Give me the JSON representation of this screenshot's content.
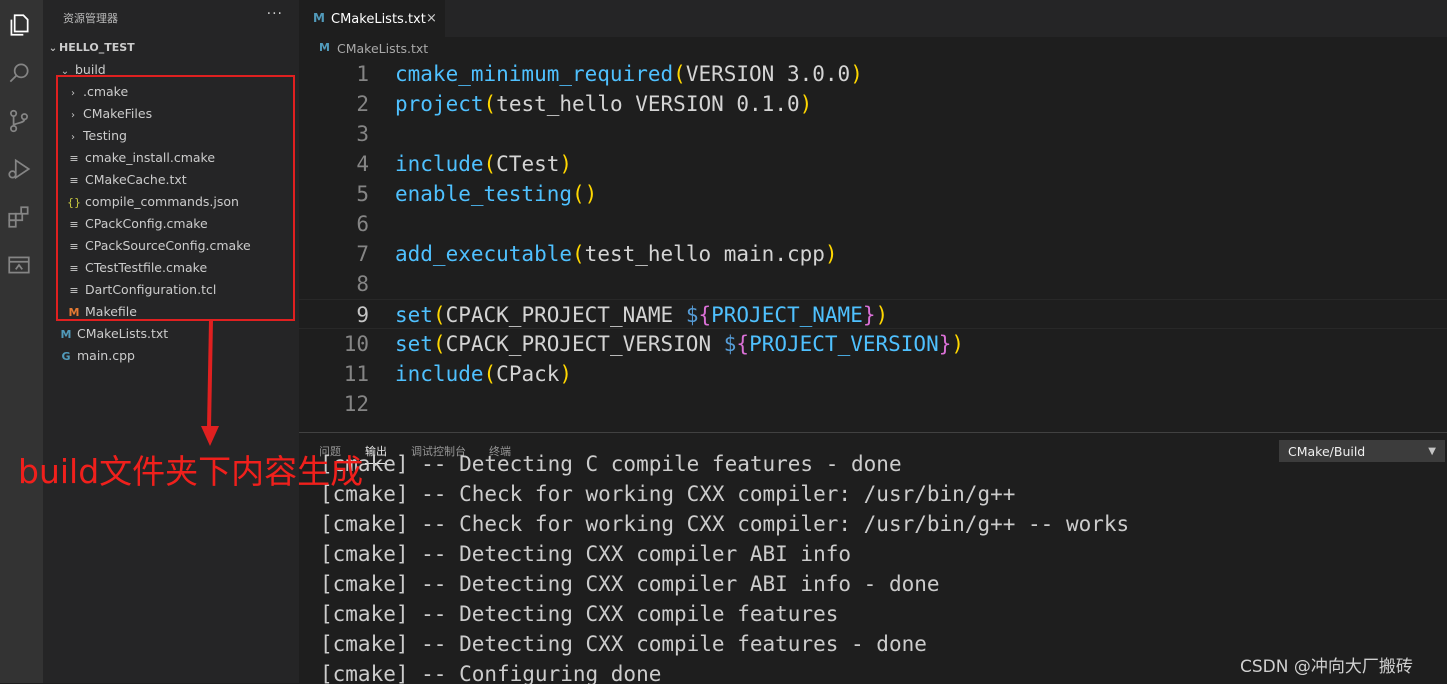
{
  "sidebar": {
    "title": "资源管理器",
    "more": "···",
    "root": "HELLO_TEST",
    "items": [
      {
        "label": "build",
        "kind": "folder-open",
        "depth": 1
      },
      {
        "label": ".cmake",
        "kind": "folder",
        "depth": 2
      },
      {
        "label": "CMakeFiles",
        "kind": "folder",
        "depth": 2
      },
      {
        "label": "Testing",
        "kind": "folder",
        "depth": 2
      },
      {
        "label": "cmake_install.cmake",
        "kind": "file-lines",
        "depth": 2
      },
      {
        "label": "CMakeCache.txt",
        "kind": "file-lines",
        "depth": 2
      },
      {
        "label": "compile_commands.json",
        "kind": "json",
        "depth": 2
      },
      {
        "label": "CPackConfig.cmake",
        "kind": "file-lines",
        "depth": 2
      },
      {
        "label": "CPackSourceConfig.cmake",
        "kind": "file-lines",
        "depth": 2
      },
      {
        "label": "CTestTestfile.cmake",
        "kind": "file-lines",
        "depth": 2
      },
      {
        "label": "DartConfiguration.tcl",
        "kind": "file-lines",
        "depth": 2
      },
      {
        "label": "Makefile",
        "kind": "makefile",
        "depth": 2
      },
      {
        "label": "CMakeLists.txt",
        "kind": "markdown",
        "depth": 1
      },
      {
        "label": "main.cpp",
        "kind": "cpp",
        "depth": 1
      }
    ]
  },
  "tabs": [
    {
      "label": "CMakeLists.txt",
      "icon": "M",
      "close": "×"
    }
  ],
  "breadcrumb": {
    "icon": "M",
    "label": "CMakeLists.txt"
  },
  "editor": {
    "current_line": 9,
    "lines": [
      {
        "n": "1",
        "t": "cmake_minimum_required(VERSION 3.0.0)"
      },
      {
        "n": "2",
        "t": "project(test_hello VERSION 0.1.0)"
      },
      {
        "n": "3",
        "t": ""
      },
      {
        "n": "4",
        "t": "include(CTest)"
      },
      {
        "n": "5",
        "t": "enable_testing()"
      },
      {
        "n": "6",
        "t": ""
      },
      {
        "n": "7",
        "t": "add_executable(test_hello main.cpp)"
      },
      {
        "n": "8",
        "t": ""
      },
      {
        "n": "9",
        "t": "set(CPACK_PROJECT_NAME ${PROJECT_NAME})"
      },
      {
        "n": "10",
        "t": "set(CPACK_PROJECT_VERSION ${PROJECT_VERSION})"
      },
      {
        "n": "11",
        "t": "include(CPack)"
      },
      {
        "n": "12",
        "t": ""
      }
    ]
  },
  "panel": {
    "tabs": [
      "问题",
      "输出",
      "调试控制台",
      "终端"
    ],
    "active_tab": "输出",
    "channel": "CMake/Build",
    "output": [
      "[cmake] -- Detecting C compile features - done",
      "[cmake] -- Check for working CXX compiler: /usr/bin/g++",
      "[cmake] -- Check for working CXX compiler: /usr/bin/g++ -- works",
      "[cmake] -- Detecting CXX compiler ABI info",
      "[cmake] -- Detecting CXX compiler ABI info - done",
      "[cmake] -- Detecting CXX compile features",
      "[cmake] -- Detecting CXX compile features - done",
      "[cmake] -- Configuring done"
    ]
  },
  "annotation": {
    "text": "build文件夹下内容生成",
    "color": "#f0201c"
  },
  "watermark": "CSDN @冲向大厂搬砖",
  "colors": {
    "accent": "#519aba",
    "annotation_red": "#e02020"
  }
}
